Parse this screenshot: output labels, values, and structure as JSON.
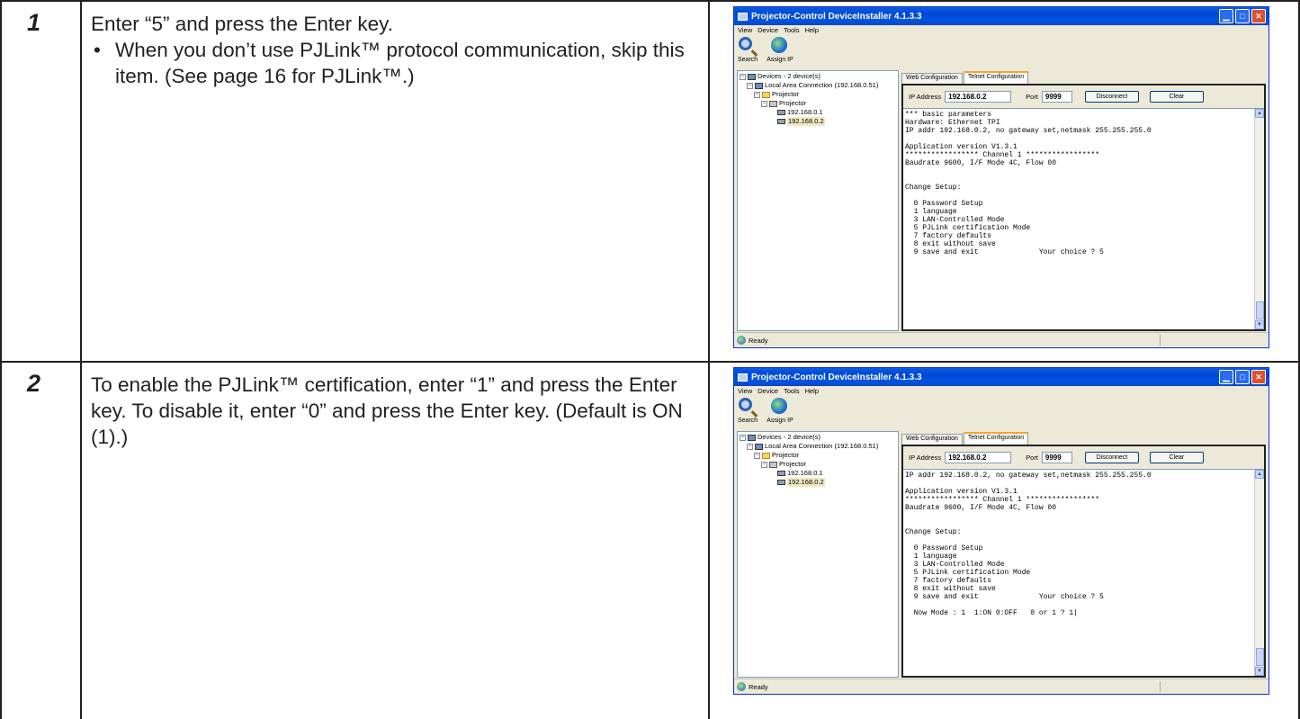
{
  "steps": [
    {
      "number": "1",
      "text": "Enter “5” and press the Enter key.",
      "bullet": "When you don’t use PJLink™ protocol communication, skip this item. (See page 16 for PJLink™.)",
      "window": {
        "title": "Projector-Control DeviceInstaller 4.1.3.3",
        "menu": [
          "View",
          "Device",
          "Tools",
          "Help"
        ],
        "toolbar": [
          "Search",
          "Assign IP"
        ],
        "tree": [
          "Devices - 2 device(s)",
          "Local Area Connection (192.168.0.51)",
          "Projector",
          "Projector",
          "192.168.0.1",
          "192.168.0.2"
        ],
        "tabs": [
          "Web Configuration",
          "Telnet Configuration"
        ],
        "ip_label": "IP Address",
        "ip_value": "192.168.0.2",
        "port_label": "Port",
        "port_value": "9999",
        "disconnect": "Disconnect",
        "clear": "Clear",
        "console": "*** basic parameters\nHardware: Ethernet TPI\nIP addr 192.168.0.2, no gateway set,netmask 255.255.255.0\n\nApplication version V1.3.1\n***************** Channel 1 *****************\nBaudrate 9600, I/F Mode 4C, Flow 00\n\n\nChange Setup:\n\n  0 Password Setup\n  1 language\n  3 LAN-Controlled Mode\n  5 PJLink certification Mode\n  7 factory defaults\n  8 exit without save\n  9 save and exit              Your choice ? 5",
        "status": "Ready"
      }
    },
    {
      "number": "2",
      "text": "To enable the PJLink™ certification, enter “1” and press the Enter key. To disable it, enter “0” and press the Enter key. (Default is ON (1).)",
      "window": {
        "title": "Projector-Control DeviceInstaller 4.1.3.3",
        "menu": [
          "View",
          "Device",
          "Tools",
          "Help"
        ],
        "toolbar": [
          "Search",
          "Assign IP"
        ],
        "tree": [
          "Devices - 2 device(s)",
          "Local Area Connection (192.168.0.51)",
          "Projector",
          "Projector",
          "192.168.0.1",
          "192.168.0.2"
        ],
        "tabs": [
          "Web Configuration",
          "Telnet Configuration"
        ],
        "ip_label": "IP Address",
        "ip_value": "192.168.0.2",
        "port_label": "Port",
        "port_value": "9999",
        "disconnect": "Disconnect",
        "clear": "Clear",
        "console": "IP addr 192.168.0.2, no gateway set,netmask 255.255.255.0\n\nApplication version V1.3.1\n***************** Channel 1 *****************\nBaudrate 9600, I/F Mode 4C, Flow 00\n\n\nChange Setup:\n\n  0 Password Setup\n  1 language\n  3 LAN-Controlled Mode\n  5 PJLink certification Mode\n  7 factory defaults\n  8 exit without save\n  9 save and exit              Your choice ? 5\n\n  Now Mode : 1  1:ON 0:OFF   0 or 1 ? 1|",
        "status": "Ready"
      }
    }
  ]
}
